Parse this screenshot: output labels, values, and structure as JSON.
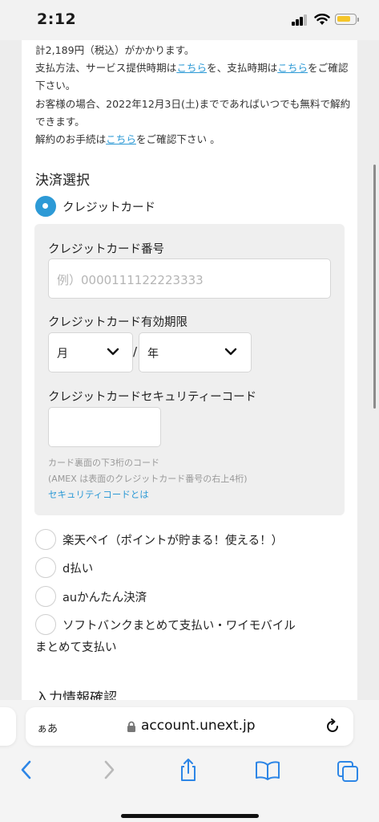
{
  "status_bar": {
    "time": "2:12"
  },
  "info": {
    "line1": "計2,189円（税込）がかかります。",
    "line2_pre": "支払方法、サービス提供時期は",
    "line2_link1": "こちら",
    "line2_mid": "を、支払時期は",
    "line2_link2": "こちら",
    "line2_post": "をご確認下さい。",
    "line3": "お客様の場合、2022年12月3日(土)までであればいつでも無料で解約できます。",
    "line4_pre": "解約のお手続は",
    "line4_link": "こちら",
    "line4_post": "をご確認下さい 。"
  },
  "payment": {
    "section_title": "決済選択",
    "credit_card_label": "クレジットカード",
    "card_number_label": "クレジットカード番号",
    "card_number_placeholder": "例）0000111122223333",
    "expiry_label": "クレジットカード有効期限",
    "month_value": "月",
    "separator": "/",
    "year_value": "年",
    "cvc_label": "クレジットカードセキュリティーコード",
    "cvc_help1": "カード裏面の下3桁のコード",
    "cvc_help2": "(AMEX は表面のクレジットカード番号の右上4桁)",
    "cvc_link": "セキュリティコードとは",
    "options": [
      {
        "label": "楽天ペイ（ポイントが貯まる！使える！）"
      },
      {
        "label": "d払い"
      },
      {
        "label": "auかんたん決済"
      },
      {
        "label_line1": "ソフトバンクまとめて支払い・ワイモバイル",
        "label_line2": "まとめて支払い"
      }
    ]
  },
  "confirm_section_title": "入力情報確認",
  "browser": {
    "aa_label": "ぁあ",
    "url": "account.unext.jp",
    "toolbar": [
      "back-icon",
      "forward-icon",
      "share-icon",
      "bookmarks-icon",
      "tabs-icon"
    ]
  },
  "colors": {
    "accent": "#2d9ad6",
    "battery": "#f5c52a"
  }
}
